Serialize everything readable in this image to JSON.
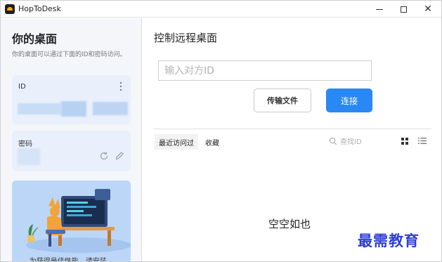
{
  "window": {
    "title": "HopToDesk",
    "minimize_glyph": "—",
    "maximize_glyph": "☐",
    "close_glyph": "✕"
  },
  "left": {
    "title": "你的桌面",
    "description": "你的桌面可以通过下面的ID和密码访问。",
    "id_card": {
      "label": "ID"
    },
    "password_card": {
      "label": "密码"
    },
    "promo": {
      "text": "为获得最佳性能，请安装..."
    }
  },
  "right": {
    "title": "控制远程桌面",
    "id_input": {
      "placeholder": "输入对方ID",
      "value": ""
    },
    "file_transfer_button": "传输文件",
    "connect_button": "连接",
    "tabs": [
      "最近访问过",
      "收藏"
    ],
    "search_placeholder": "查找ID",
    "empty_text": "空空如也"
  },
  "watermark": "最需教育",
  "icons": {
    "app": "hoptodesk-logo-icon",
    "more": "more-vertical-icon",
    "refresh": "refresh-icon",
    "edit": "pencil-icon",
    "search": "search-icon",
    "grid_view": "grid-view-icon",
    "list_view": "list-view-icon"
  },
  "colors": {
    "accent": "#2a88f5",
    "card_bg": "#e9f0fb",
    "sidebar_bg": "#f4f6fa",
    "watermark": "#2e3ed8"
  }
}
